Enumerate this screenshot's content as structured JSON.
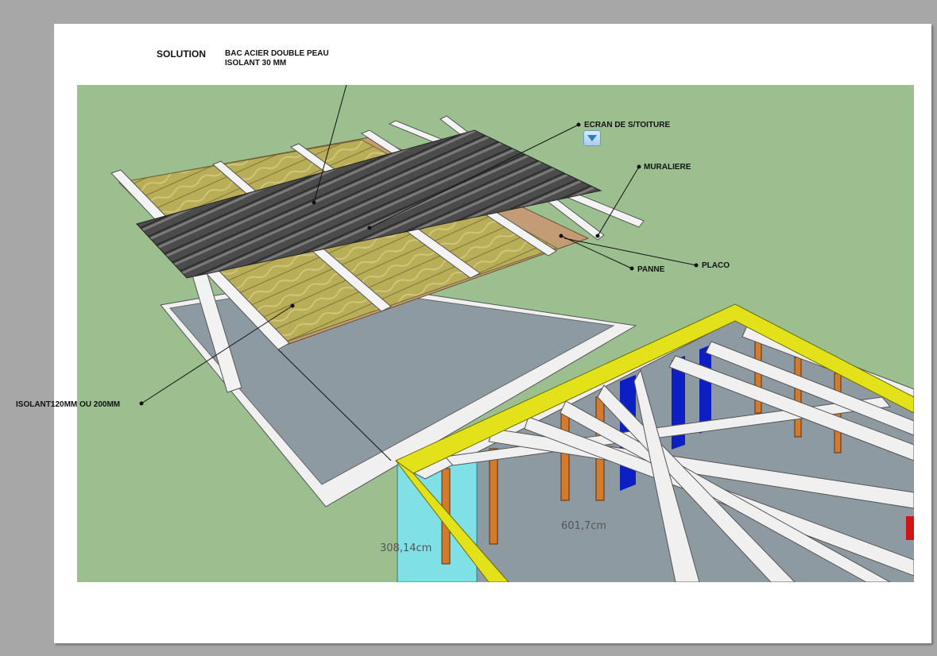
{
  "header": {
    "title": "SOLUTION",
    "line1": "BAC ACIER DOUBLE PEAU",
    "line2": "ISOLANT 30 MM"
  },
  "labels": {
    "ecran": "ECRAN DE S/TOITURE",
    "muraliere": "MURALIERE",
    "panne": "PANNE",
    "placo": "PLACO",
    "isolant": "ISOLANT120MM OU 200MM"
  },
  "dimensions": {
    "d1": "308,14cm",
    "d2": "601,7cm"
  },
  "colors": {
    "background": "#9cbf8f",
    "page_border": "#a7a7a7",
    "steel_deck": "#4a4a4a",
    "insulation": "#b8ab55",
    "placo": "#c8a27a",
    "plasterboard_floor": "#8e9aa1",
    "beam": "#eeeeee",
    "top_plate": "#e3e11a",
    "stud": "#d47a2c",
    "blue_insulation": "#0d1fc2",
    "glass": "#7fe0e6"
  },
  "icons": {
    "dropdown": "dropdown-arrow-icon"
  }
}
